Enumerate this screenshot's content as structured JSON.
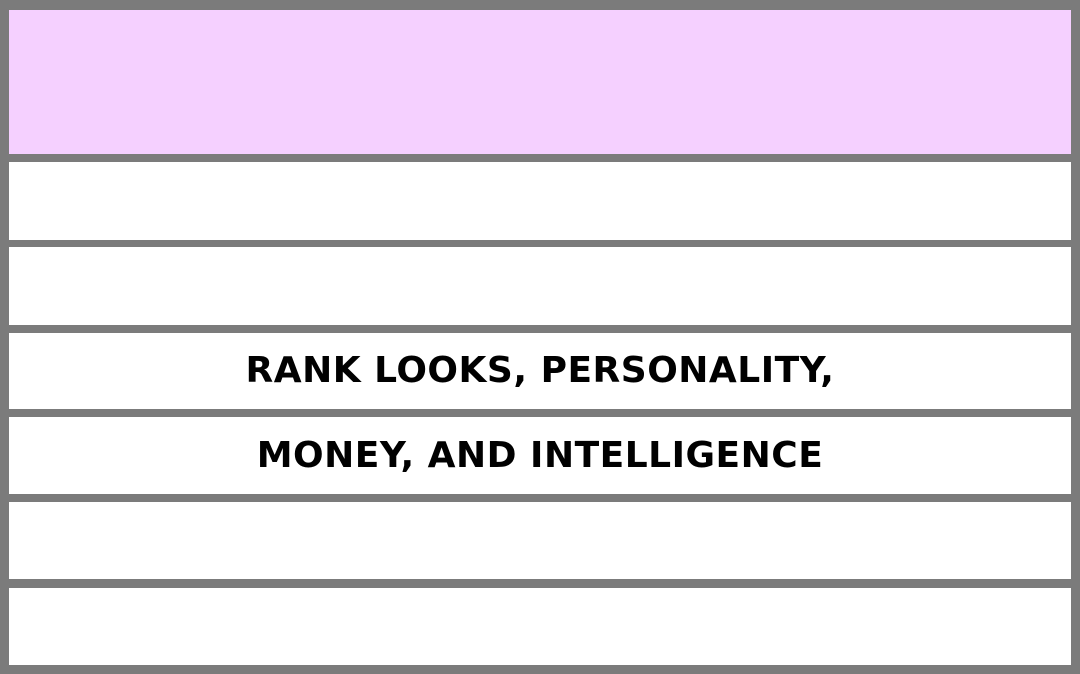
{
  "colors": {
    "border": "#7b7b7b",
    "header_band": "#f5d0ff",
    "row_band": "#ffffff",
    "text": "#000000"
  },
  "rows": [
    {
      "text": ""
    },
    {
      "text": ""
    },
    {
      "text": ""
    },
    {
      "text": "RANK LOOKS, PERSONALITY,"
    },
    {
      "text": "MONEY, AND INTELLIGENCE"
    },
    {
      "text": ""
    },
    {
      "text": ""
    }
  ]
}
